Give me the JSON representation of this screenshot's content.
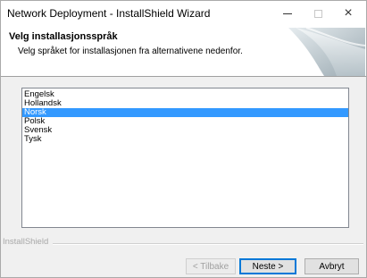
{
  "window": {
    "title": "Network Deployment - InstallShield Wizard",
    "controls": {
      "minimize_icon": "minimize-icon",
      "maximize_icon": "maximize-icon",
      "close_icon": "close-icon",
      "close_glyph": "×"
    }
  },
  "header": {
    "title": "Velg installasjonsspråk",
    "subtitle": "Velg språket for installasjonen fra alternativene nedenfor."
  },
  "languages": {
    "items": [
      {
        "label": "Engelsk",
        "selected": false
      },
      {
        "label": "Hollandsk",
        "selected": false
      },
      {
        "label": "Norsk",
        "selected": true
      },
      {
        "label": "Polsk",
        "selected": false
      },
      {
        "label": "Svensk",
        "selected": false
      },
      {
        "label": "Tysk",
        "selected": false
      }
    ],
    "selected_value": "Norsk"
  },
  "footer": {
    "brand": "InstallShield",
    "back_label": "< Tilbake",
    "next_label": "Neste >",
    "cancel_label": "Avbryt"
  },
  "colors": {
    "selection": "#3399ff",
    "focus_border": "#0078d7",
    "disabled_text": "#a0a0a0"
  }
}
